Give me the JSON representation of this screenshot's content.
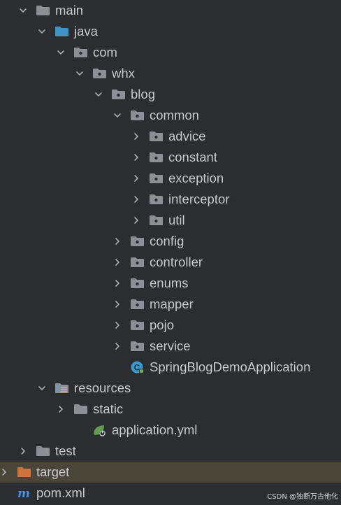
{
  "tree": [
    {
      "label": "main",
      "depth": 0,
      "arrow": "expanded",
      "icon": "folder-icon",
      "color": "#8c9096"
    },
    {
      "label": "java",
      "depth": 1,
      "arrow": "expanded",
      "icon": "source-folder-icon",
      "color": "#3f93c7"
    },
    {
      "label": "com",
      "depth": 2,
      "arrow": "expanded",
      "icon": "package-icon",
      "color": "#8c9096"
    },
    {
      "label": "whx",
      "depth": 3,
      "arrow": "expanded",
      "icon": "package-icon",
      "color": "#8c9096"
    },
    {
      "label": "blog",
      "depth": 4,
      "arrow": "expanded",
      "icon": "package-icon",
      "color": "#8c9096"
    },
    {
      "label": "common",
      "depth": 5,
      "arrow": "expanded",
      "icon": "package-icon",
      "color": "#8c9096"
    },
    {
      "label": "advice",
      "depth": 6,
      "arrow": "collapsed",
      "icon": "package-icon",
      "color": "#8c9096"
    },
    {
      "label": "constant",
      "depth": 6,
      "arrow": "collapsed",
      "icon": "package-icon",
      "color": "#8c9096"
    },
    {
      "label": "exception",
      "depth": 6,
      "arrow": "collapsed",
      "icon": "package-icon",
      "color": "#8c9096"
    },
    {
      "label": "interceptor",
      "depth": 6,
      "arrow": "collapsed",
      "icon": "package-icon",
      "color": "#8c9096"
    },
    {
      "label": "util",
      "depth": 6,
      "arrow": "collapsed",
      "icon": "package-icon",
      "color": "#8c9096"
    },
    {
      "label": "config",
      "depth": 5,
      "arrow": "collapsed",
      "icon": "package-icon",
      "color": "#8c9096"
    },
    {
      "label": "controller",
      "depth": 5,
      "arrow": "collapsed",
      "icon": "package-icon",
      "color": "#8c9096"
    },
    {
      "label": "enums",
      "depth": 5,
      "arrow": "collapsed",
      "icon": "package-icon",
      "color": "#8c9096"
    },
    {
      "label": "mapper",
      "depth": 5,
      "arrow": "collapsed",
      "icon": "package-icon",
      "color": "#8c9096"
    },
    {
      "label": "pojo",
      "depth": 5,
      "arrow": "collapsed",
      "icon": "package-icon",
      "color": "#8c9096"
    },
    {
      "label": "service",
      "depth": 5,
      "arrow": "collapsed",
      "icon": "package-icon",
      "color": "#8c9096"
    },
    {
      "label": "SpringBlogDemoApplication",
      "depth": 5,
      "arrow": "none",
      "icon": "spring-class-icon",
      "color": "#3a9bd0"
    },
    {
      "label": "resources",
      "depth": 1,
      "arrow": "expanded",
      "icon": "resources-folder-icon",
      "color": "#8c9096"
    },
    {
      "label": "static",
      "depth": 2,
      "arrow": "collapsed",
      "icon": "folder-icon",
      "color": "#8c9096"
    },
    {
      "label": "application.yml",
      "depth": 3,
      "arrow": "none",
      "icon": "spring-config-icon",
      "color": "#5f9d4f"
    },
    {
      "label": "test",
      "depth": 0,
      "arrow": "collapsed",
      "icon": "folder-icon",
      "color": "#8c9096"
    },
    {
      "label": "target",
      "depth": -1,
      "arrow": "collapsed",
      "icon": "excluded-folder-icon",
      "color": "#d0733a",
      "highlight": true
    },
    {
      "label": "pom.xml",
      "depth": -1,
      "arrow": "none",
      "icon": "maven-icon",
      "color": "#4a8ee3"
    }
  ],
  "watermark": "CSDN @独断万古他化"
}
